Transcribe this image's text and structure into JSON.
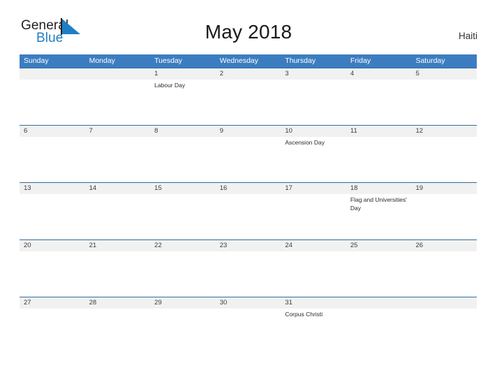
{
  "brand": {
    "name_part1": "General",
    "name_part2": "Blue",
    "flag_icon": "flag-triangle-icon",
    "accent_color": "#1f7ec4"
  },
  "header": {
    "title": "May 2018",
    "region": "Haiti"
  },
  "calendar": {
    "header_bg": "#3b7dc0",
    "date_strip_bg": "#f1f1f1",
    "rule_color": "#2e6da4",
    "weekdays": [
      "Sunday",
      "Monday",
      "Tuesday",
      "Wednesday",
      "Thursday",
      "Friday",
      "Saturday"
    ],
    "weeks": [
      {
        "days": [
          {
            "date": "",
            "event": ""
          },
          {
            "date": "",
            "event": ""
          },
          {
            "date": "1",
            "event": "Labour Day"
          },
          {
            "date": "2",
            "event": ""
          },
          {
            "date": "3",
            "event": ""
          },
          {
            "date": "4",
            "event": ""
          },
          {
            "date": "5",
            "event": ""
          }
        ]
      },
      {
        "days": [
          {
            "date": "6",
            "event": ""
          },
          {
            "date": "7",
            "event": ""
          },
          {
            "date": "8",
            "event": ""
          },
          {
            "date": "9",
            "event": ""
          },
          {
            "date": "10",
            "event": "Ascension Day"
          },
          {
            "date": "11",
            "event": ""
          },
          {
            "date": "12",
            "event": ""
          }
        ]
      },
      {
        "days": [
          {
            "date": "13",
            "event": ""
          },
          {
            "date": "14",
            "event": ""
          },
          {
            "date": "15",
            "event": ""
          },
          {
            "date": "16",
            "event": ""
          },
          {
            "date": "17",
            "event": ""
          },
          {
            "date": "18",
            "event": "Flag and Universities' Day"
          },
          {
            "date": "19",
            "event": ""
          }
        ]
      },
      {
        "days": [
          {
            "date": "20",
            "event": ""
          },
          {
            "date": "21",
            "event": ""
          },
          {
            "date": "22",
            "event": ""
          },
          {
            "date": "23",
            "event": ""
          },
          {
            "date": "24",
            "event": ""
          },
          {
            "date": "25",
            "event": ""
          },
          {
            "date": "26",
            "event": ""
          }
        ]
      },
      {
        "days": [
          {
            "date": "27",
            "event": ""
          },
          {
            "date": "28",
            "event": ""
          },
          {
            "date": "29",
            "event": ""
          },
          {
            "date": "30",
            "event": ""
          },
          {
            "date": "31",
            "event": "Corpus Christi"
          },
          {
            "date": "",
            "event": ""
          },
          {
            "date": "",
            "event": ""
          }
        ]
      }
    ]
  }
}
